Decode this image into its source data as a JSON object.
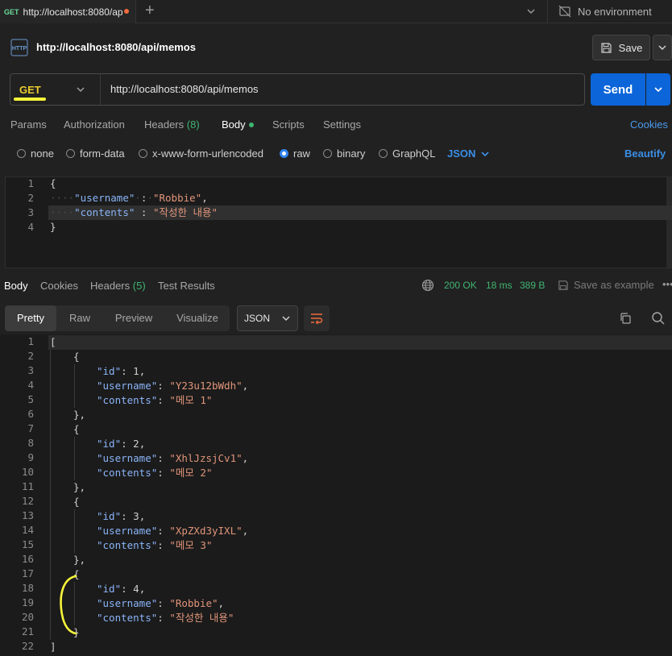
{
  "tabbar": {
    "tab_method": "GET",
    "tab_title": "http://localhost:8080/ap",
    "environment": "No environment"
  },
  "request": {
    "title": "http://localhost:8080/api/memos",
    "save_label": "Save",
    "method": "GET",
    "url": "http://localhost:8080/api/memos",
    "send_label": "Send"
  },
  "req_tabs": {
    "params": "Params",
    "authorization": "Authorization",
    "headers": "Headers",
    "headers_count": "(8)",
    "body": "Body",
    "scripts": "Scripts",
    "settings": "Settings",
    "cookies": "Cookies"
  },
  "body_types": {
    "none": "none",
    "form_data": "form-data",
    "urlencoded": "x-www-form-urlencoded",
    "raw": "raw",
    "binary": "binary",
    "graphql": "GraphQL",
    "format": "JSON",
    "beautify": "Beautify",
    "selected": "raw"
  },
  "request_body": {
    "line_numbers": [
      "1",
      "2",
      "3",
      "4"
    ],
    "open": "{",
    "username_key": "\"username\"",
    "username_val": "\"Robbie\"",
    "contents_key": "\"contents\"",
    "contents_val": "\"작성한 내용\"",
    "close": "}"
  },
  "response_tabs": {
    "body": "Body",
    "cookies": "Cookies",
    "headers": "Headers",
    "headers_count": "(5)",
    "test_results": "Test Results",
    "status": "200 OK",
    "time": "18 ms",
    "size": "389 B",
    "save_example": "Save as example"
  },
  "response_view": {
    "pretty": "Pretty",
    "raw": "Raw",
    "preview": "Preview",
    "visualize": "Visualize",
    "format": "JSON"
  },
  "response_body": {
    "items": [
      {
        "id": "1",
        "username": "\"Y23u12bWdh\"",
        "contents": "\"메모 1\""
      },
      {
        "id": "2",
        "username": "\"XhlJzsjCv1\"",
        "contents": "\"메모 2\""
      },
      {
        "id": "3",
        "username": "\"XpZXd3yIXL\"",
        "contents": "\"메모 3\""
      },
      {
        "id": "4",
        "username": "\"Robbie\"",
        "contents": "\"작성한 내용\""
      }
    ]
  },
  "colors": {
    "accent_blue": "#0c65d9",
    "method_get": "#eacb2e",
    "success_green": "#3fb571",
    "annotation_yellow": "#f8f53a"
  }
}
